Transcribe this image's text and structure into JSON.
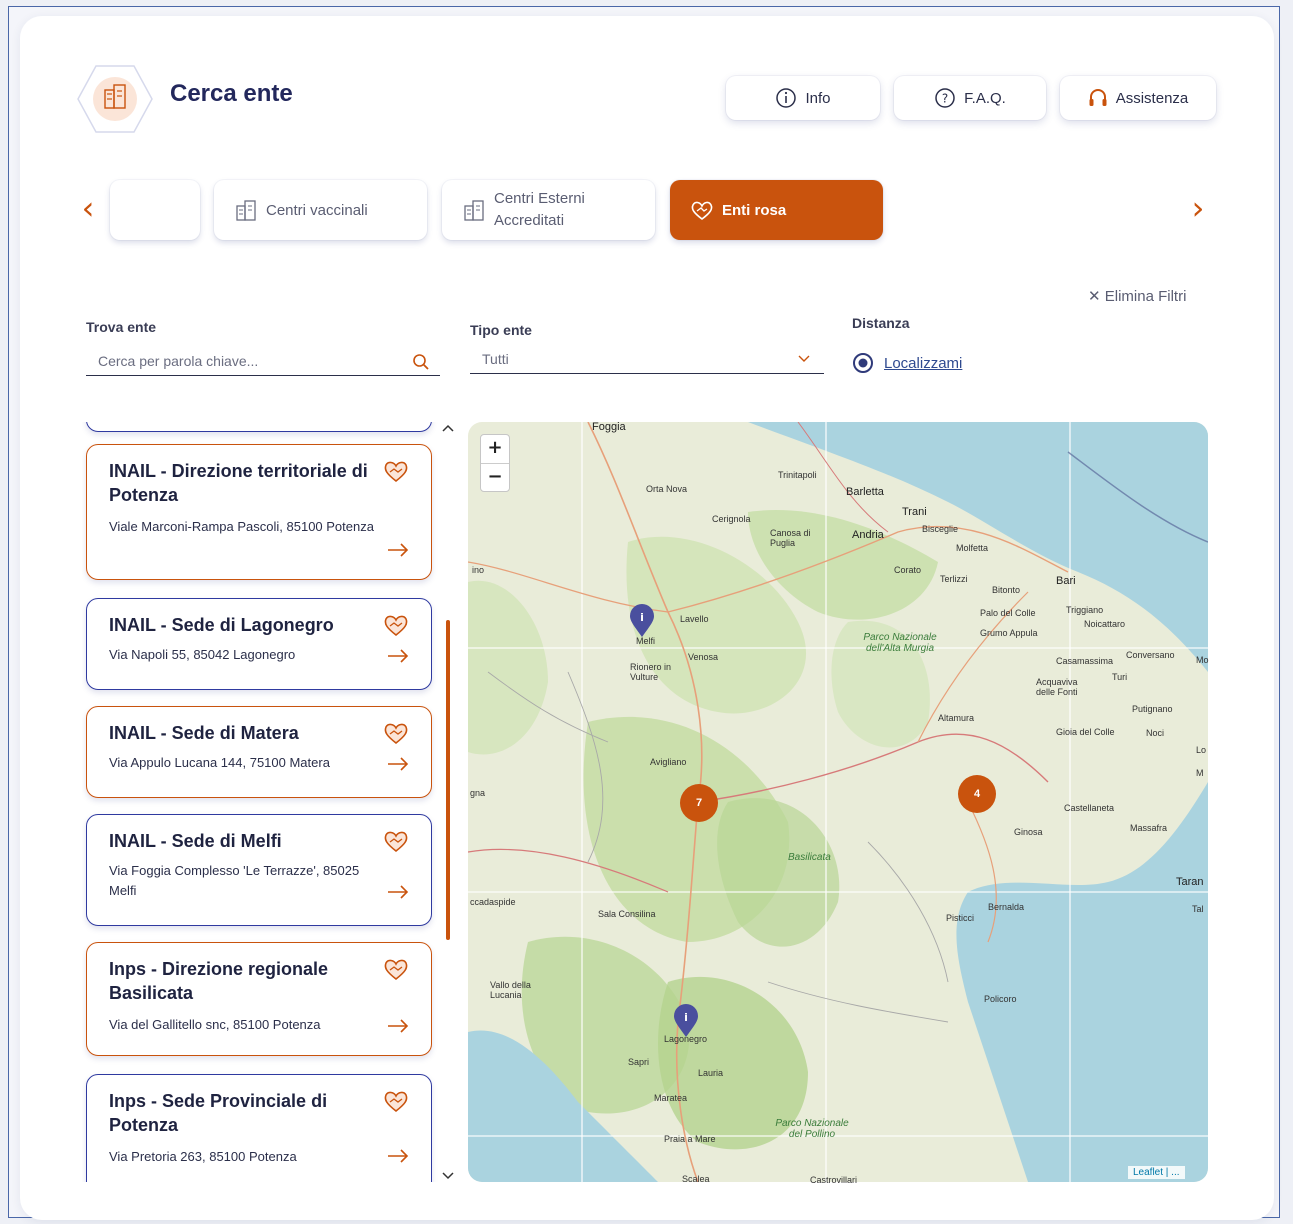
{
  "header": {
    "title": "Cerca ente",
    "buttons": {
      "info": "Info",
      "faq": "F.A.Q.",
      "assistenza": "Assistenza"
    }
  },
  "categories": {
    "tabs": [
      {
        "label": "Centri vaccinali",
        "active": false
      },
      {
        "label_line1": "Centri Esterni",
        "label_line2": "Accreditati",
        "active": false
      },
      {
        "label": "Enti rosa",
        "active": true
      }
    ]
  },
  "filters": {
    "clear_label": "Elimina Filtri",
    "search": {
      "label": "Trova ente",
      "placeholder": "Cerca per parola chiave..."
    },
    "type": {
      "label": "Tipo ente",
      "value": "Tutti"
    },
    "distance": {
      "label": "Distanza",
      "action": "Localizzami"
    }
  },
  "list": [
    {
      "title": "INAIL - Direzione territoriale di Potenza",
      "address": "Viale Marconi-Rampa Pascoli, 85100 Potenza"
    },
    {
      "title": "INAIL - Sede di Lagonegro",
      "address": "Via Napoli 55, 85042 Lagonegro"
    },
    {
      "title": "INAIL - Sede di Matera",
      "address": "Via Appulo Lucana 144, 75100 Matera"
    },
    {
      "title": "INAIL - Sede di Melfi",
      "address": "Via Foggia Complesso 'Le Terrazze', 85025 Melfi"
    },
    {
      "title": "Inps - Direzione regionale Basilicata",
      "address": "Via del Gallitello snc, 85100 Potenza"
    },
    {
      "title": "Inps - Sede Provinciale di Potenza",
      "address": "Via Pretoria 263, 85100 Potenza"
    }
  ],
  "map": {
    "zoom_in": "+",
    "zoom_out": "−",
    "clusters": [
      "7",
      "4"
    ],
    "attribution": "Leaflet | ...",
    "labels": {
      "foggia": "Foggia",
      "ortanova": "Orta Nova",
      "trinitapoli": "Trinitapoli",
      "barletta": "Barletta",
      "trani": "Trani",
      "bisceglie": "Bisceglie",
      "andria": "Andria",
      "molfetta": "Molfetta",
      "cerignola": "Cerignola",
      "canosa": "Canosa di Puglia",
      "corato": "Corato",
      "terlizzi": "Terlizzi",
      "bitonto": "Bitonto",
      "bari": "Bari",
      "melfi": "Melfi",
      "lavello": "Lavello",
      "venosa": "Venosa",
      "rionero": "Rionero in Vulture",
      "palo": "Palo del Colle",
      "triggiano": "Triggiano",
      "noicattaro": "Noicattaro",
      "gravina": "Grumo Appula",
      "parco_murgia": "Parco Nazionale dell'Alta Murgia",
      "casamassima": "Casamassima",
      "conversano": "Conversano",
      "acquaviva": "Acquaviva delle Fonti",
      "turi": "Turi",
      "putignano": "Putignano",
      "altamura": "Altamura",
      "gioia": "Gioia del Colle",
      "noci": "Noci",
      "avigliano": "Avigliano",
      "castellaneta": "Castellaneta",
      "massafra": "Massafra",
      "ginosa": "Ginosa",
      "basilicata": "Basilicata",
      "bernalda": "Bernalda",
      "pisticci": "Pisticci",
      "sala": "Sala Consilina",
      "policoro": "Policoro",
      "vallo": "Vallo della Lucania",
      "lagonegro": "Lagonegro",
      "sapri": "Sapri",
      "lauria": "Lauria",
      "maratea": "Maratea",
      "parco_pollino": "Parco Nazionale del Pollino",
      "praia": "Praia a Mare",
      "scalea": "Scalea",
      "castrovillari": "Castrovillari",
      "ino": "ino",
      "na": "gna",
      "ccadaspide": "ccadaspide",
      "taran": "Taran",
      "tal": "Tal",
      "lo": "Lo",
      "m": "M",
      "mo": "Mo"
    }
  },
  "colors": {
    "accent": "#c9530d",
    "navy": "#23285c",
    "border_blue": "#2f3aa0"
  }
}
